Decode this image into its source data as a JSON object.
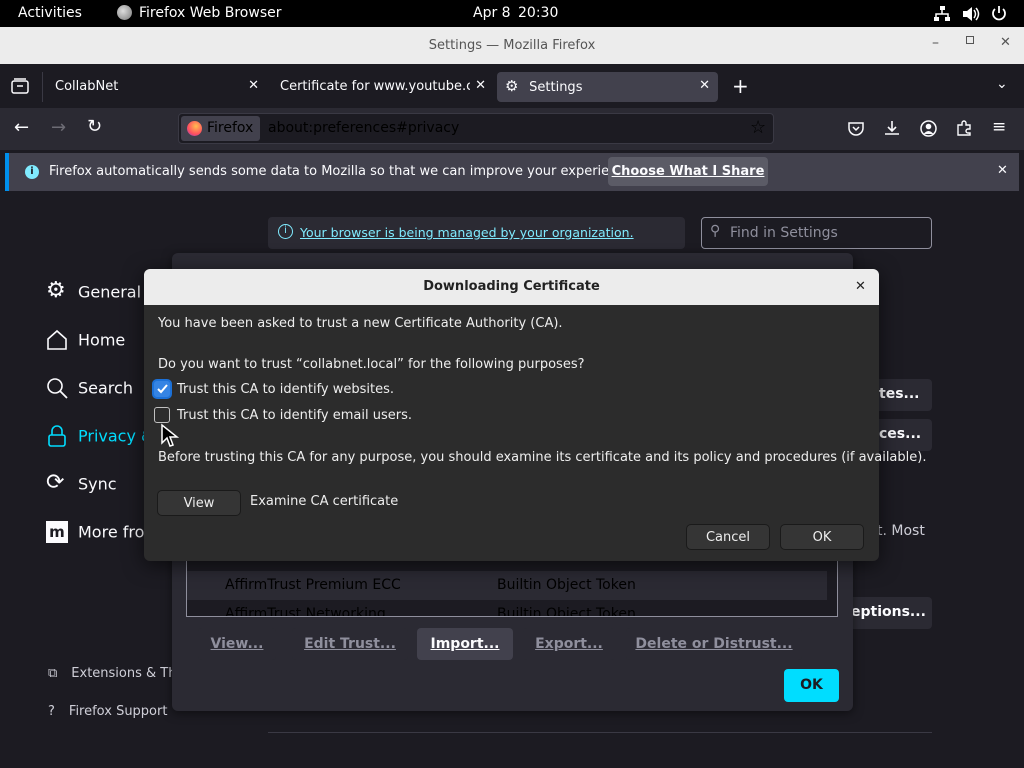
{
  "topbar": {
    "activities": "Activities",
    "app_name": "Firefox Web Browser",
    "date": "Apr 8",
    "time": "20:30"
  },
  "window": {
    "title": "Settings — Mozilla Firefox"
  },
  "tabs": [
    {
      "label": "CollabNet"
    },
    {
      "label": "Certificate for www.youtube.co"
    },
    {
      "label": "Settings"
    }
  ],
  "urlbar": {
    "identity": "Firefox",
    "url": "about:preferences#privacy"
  },
  "notification": {
    "message": "Firefox automatically sends some data to Mozilla so that we can improve your experience.",
    "button": "Choose What I Share"
  },
  "settings": {
    "managed_notice": "Your browser is being managed by your organization.",
    "search_placeholder": "Find in Settings",
    "sidebar": [
      {
        "label": "General"
      },
      {
        "label": "Home"
      },
      {
        "label": "Search"
      },
      {
        "label": "Privacy &"
      },
      {
        "label": "Sync"
      },
      {
        "label": "More fro"
      }
    ],
    "footer": [
      {
        "label": "Extensions & Th"
      },
      {
        "label": "Firefox Support"
      }
    ],
    "partial_right": {
      "a": "tes...",
      "b": "ces...",
      "c": "t. Most",
      "d": "eptions..."
    }
  },
  "cert_manager": {
    "rows": [
      {
        "name": "AffirmTrust Premium ECC",
        "device": "Builtin Object Token"
      },
      {
        "name": "AffirmTrust Networking",
        "device": "Builtin Object Token"
      }
    ],
    "buttons": {
      "view": "View...",
      "edit": "Edit Trust...",
      "import": "Import...",
      "export": "Export...",
      "delete": "Delete or Distrust..."
    },
    "ok": "OK"
  },
  "dialog": {
    "title": "Downloading Certificate",
    "intro": "You have been asked to trust a new Certificate Authority (CA).",
    "question": "Do you want to trust “collabnet.local” for the following purposes?",
    "checkbox_websites": {
      "label": "Trust this CA to identify websites.",
      "checked": true
    },
    "checkbox_email": {
      "label": "Trust this CA to identify email users.",
      "checked": false
    },
    "warning": "Before trusting this CA for any purpose, you should examine its certificate and its policy and procedures (if available).",
    "view_button": "View",
    "view_caption": "Examine CA certificate",
    "cancel": "Cancel",
    "ok": "OK"
  },
  "colors": {
    "accent": "#0090ed",
    "checkbox": "#3584e4",
    "ok_button": "#00ddff"
  }
}
